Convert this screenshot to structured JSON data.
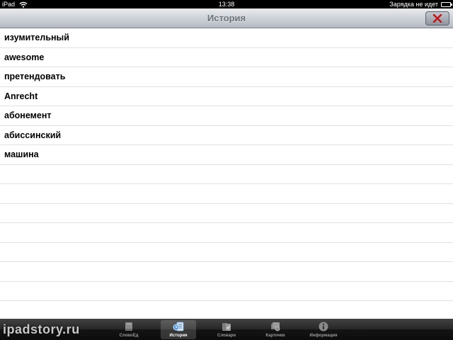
{
  "status_bar": {
    "device": "iPad",
    "time": "13:38",
    "charging": "Зарядка не идет"
  },
  "nav_bar": {
    "title": "История"
  },
  "history": {
    "items": [
      "изумительный",
      "awesome",
      "претендовать",
      "Anrecht",
      "абонемент",
      "абиссинский",
      "машина"
    ]
  },
  "tab_bar": {
    "tabs": [
      {
        "label": "СловоЕд",
        "icon": "book-icon"
      },
      {
        "label": "История",
        "icon": "history-list-icon",
        "selected": true
      },
      {
        "label": "Словари",
        "icon": "dictionaries-icon"
      },
      {
        "label": "Карточки",
        "icon": "flashcards-icon"
      },
      {
        "label": "Информация",
        "icon": "info-icon"
      }
    ]
  },
  "watermark": "ipadstory.ru",
  "colors": {
    "nav_title": "#6c737d",
    "close_x": "#c4161c",
    "tab_bar": "#141414"
  }
}
